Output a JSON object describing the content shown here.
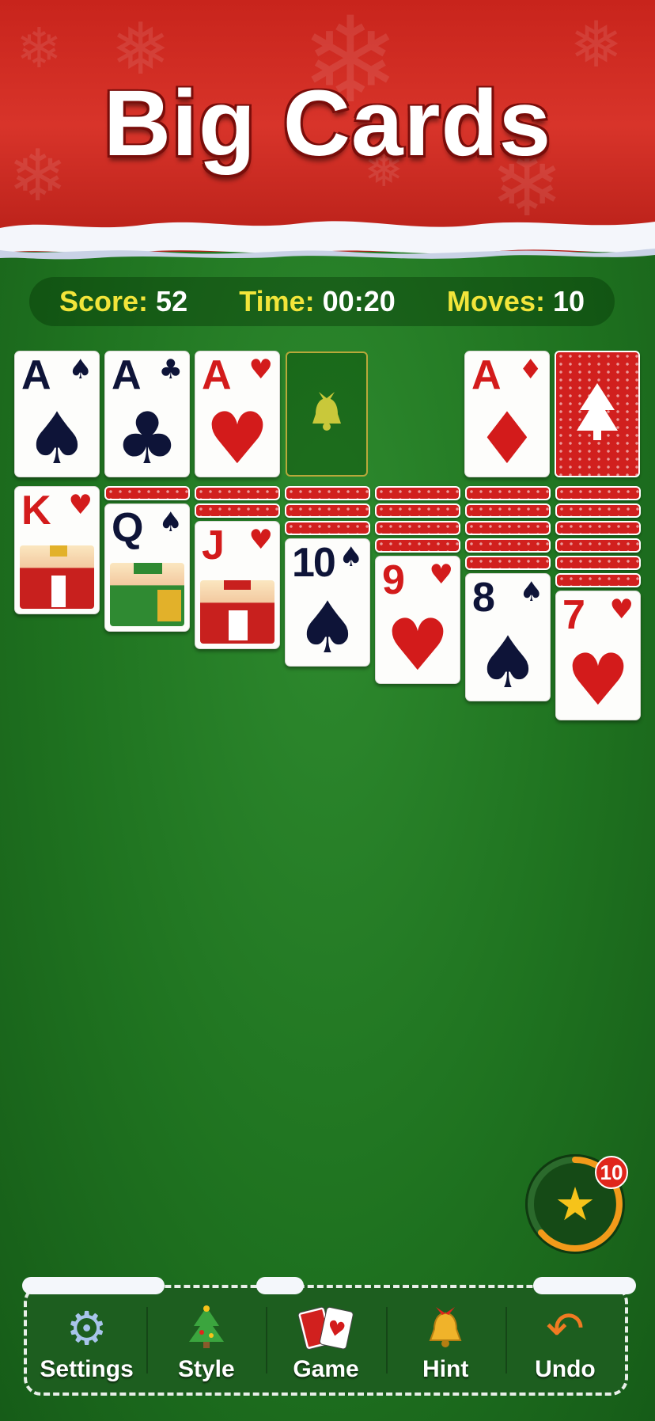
{
  "banner": {
    "title": "Big Cards"
  },
  "stats": {
    "score_label": "Score:",
    "score_value": "52",
    "time_label": "Time:",
    "time_value": "00:20",
    "moves_label": "Moves:",
    "moves_value": "10"
  },
  "foundations": [
    {
      "rank": "A",
      "suit": "♠",
      "color": "black"
    },
    {
      "rank": "A",
      "suit": "♣",
      "color": "black"
    },
    {
      "rank": "A",
      "suit": "♥",
      "color": "red"
    }
  ],
  "waste": {
    "rank": "A",
    "suit": "♦",
    "color": "red"
  },
  "empty_slot_icon": "bell-icon",
  "tableau": [
    {
      "hidden": 0,
      "rank": "K",
      "suit": "♥",
      "color": "red",
      "face": "king-figure"
    },
    {
      "hidden": 1,
      "rank": "Q",
      "suit": "♠",
      "color": "black",
      "face": "queen-figure"
    },
    {
      "hidden": 2,
      "rank": "J",
      "suit": "♥",
      "color": "red",
      "face": "jack-figure"
    },
    {
      "hidden": 3,
      "rank": "10",
      "suit": "♠",
      "color": "black"
    },
    {
      "hidden": 4,
      "rank": "9",
      "suit": "♥",
      "color": "red"
    },
    {
      "hidden": 5,
      "rank": "8",
      "suit": "♠",
      "color": "black"
    },
    {
      "hidden": 6,
      "rank": "7",
      "suit": "♥",
      "color": "red"
    }
  ],
  "helper": {
    "count": "10",
    "icon": "magic-wand-icon"
  },
  "toolbar": {
    "settings_label": "Settings",
    "style_label": "Style",
    "game_label": "Game",
    "hint_label": "Hint",
    "undo_label": "Undo"
  },
  "colors": {
    "felt": "#1f7320",
    "banner": "#c8241c",
    "score_text": "#f2e53a",
    "card_red": "#d31b1b",
    "card_black": "#0e1438"
  }
}
